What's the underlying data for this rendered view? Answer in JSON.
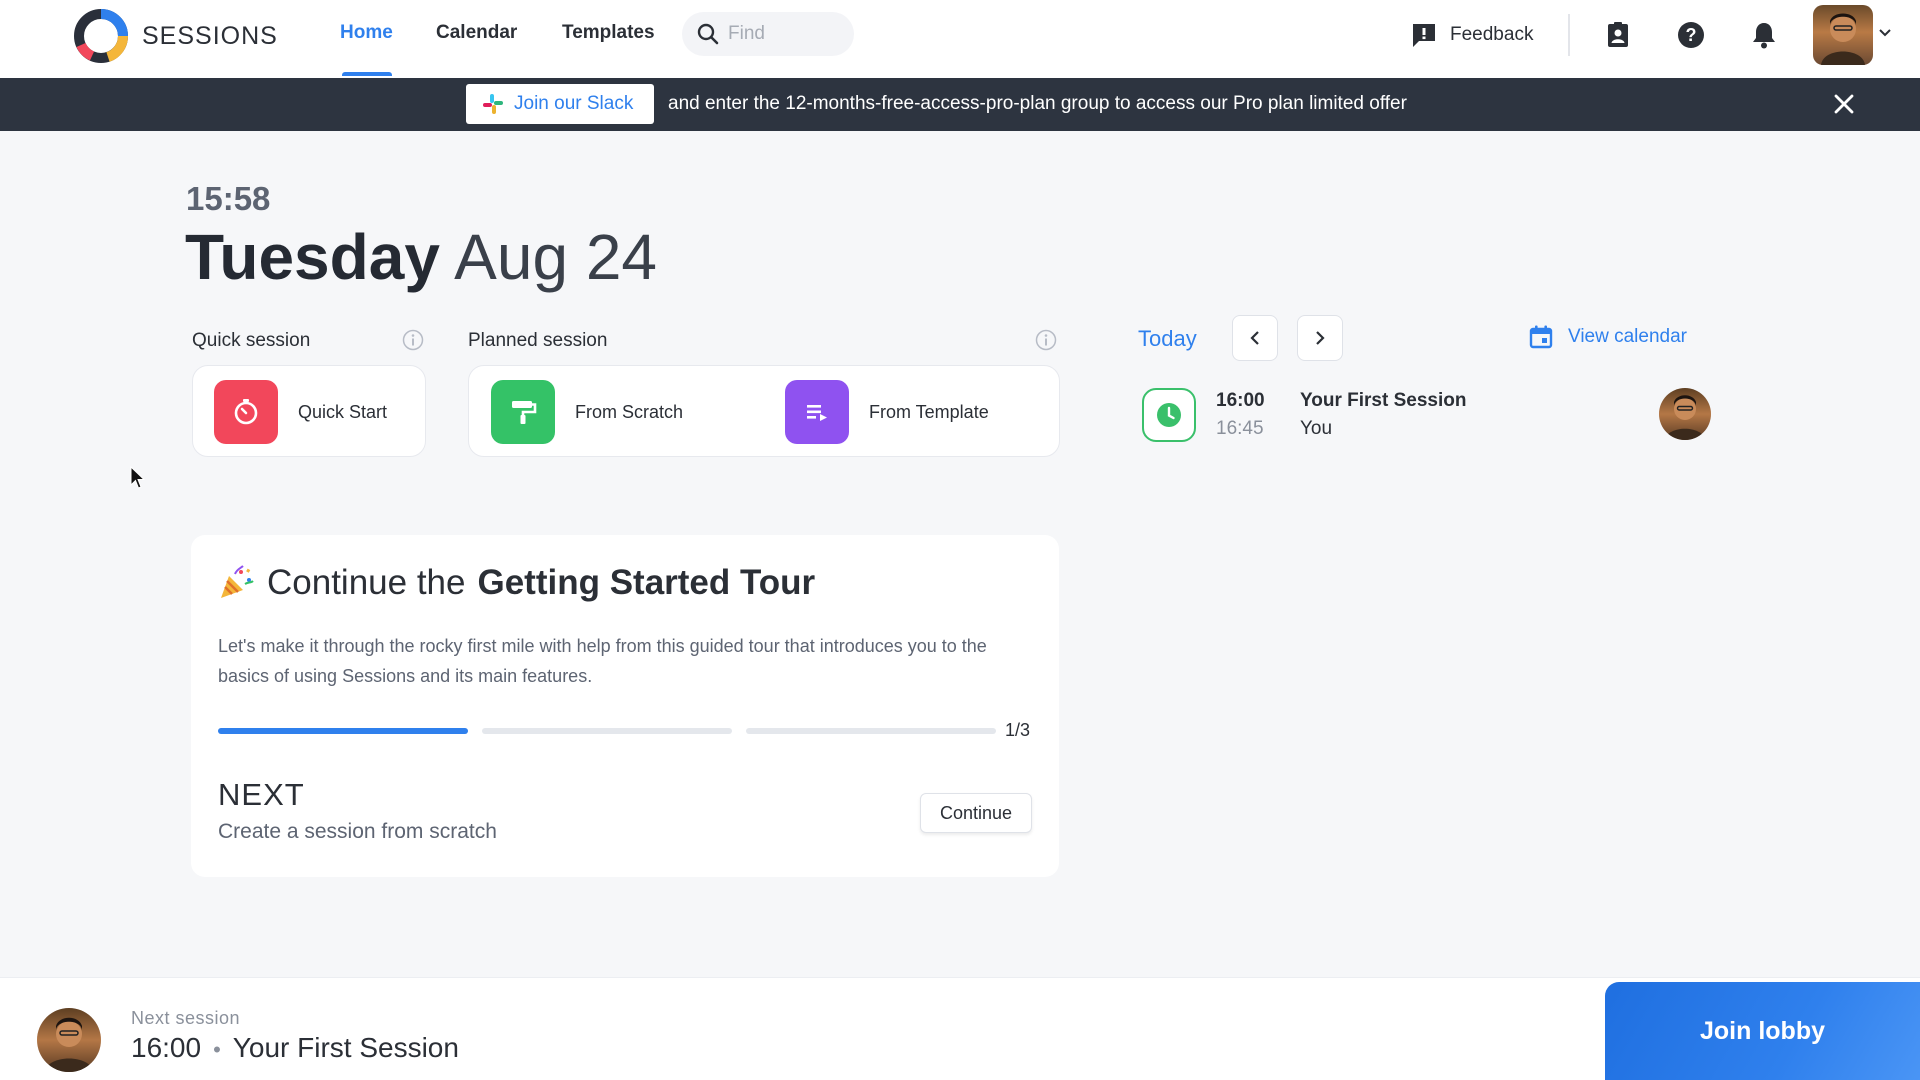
{
  "app": {
    "brand": "SESSIONS",
    "accent_color": "#2f80ed"
  },
  "nav": {
    "items": [
      {
        "label": "Home",
        "active": true
      },
      {
        "label": "Calendar",
        "active": false
      },
      {
        "label": "Templates",
        "active": false
      }
    ],
    "search_placeholder": "Find",
    "feedback_label": "Feedback",
    "icons": [
      "contacts-icon",
      "help-icon",
      "bell-icon",
      "avatar",
      "chevron-down-icon"
    ]
  },
  "banner": {
    "slack_button_label": "Join our Slack",
    "text": "and enter the 12-months-free-access-pro-plan group to access our Pro plan limited offer",
    "background": "#2d3440"
  },
  "header": {
    "time": "15:58",
    "weekday": "Tuesday",
    "month_day": "Aug 24"
  },
  "quick_session": {
    "label": "Quick session",
    "button_label": "Quick Start",
    "icon_color": "#f2475b"
  },
  "planned_session": {
    "label": "Planned session",
    "from_scratch_label": "From Scratch",
    "from_scratch_color": "#34c267",
    "from_template_label": "From Template",
    "from_template_color": "#8f52f0"
  },
  "today_panel": {
    "label": "Today",
    "view_calendar_label": "View calendar",
    "sessions": [
      {
        "start": "16:00",
        "end": "16:45",
        "title": "Your First Session",
        "host": "You"
      }
    ]
  },
  "tour": {
    "title_prefix": "Continue the",
    "title_bold": "Getting Started Tour",
    "description": "Let's make it through the rocky first mile with help from this guided tour that introduces you to the basics of using Sessions and its main features.",
    "steps_completed": 1,
    "steps_total": 3,
    "progress_label": "1/3",
    "next_heading": "NEXT",
    "next_description": "Create a session from scratch",
    "continue_label": "Continue"
  },
  "bottom_bar": {
    "label": "Next session",
    "time": "16:00",
    "separator": "•",
    "title": "Your First Session",
    "join_label": "Join lobby"
  }
}
